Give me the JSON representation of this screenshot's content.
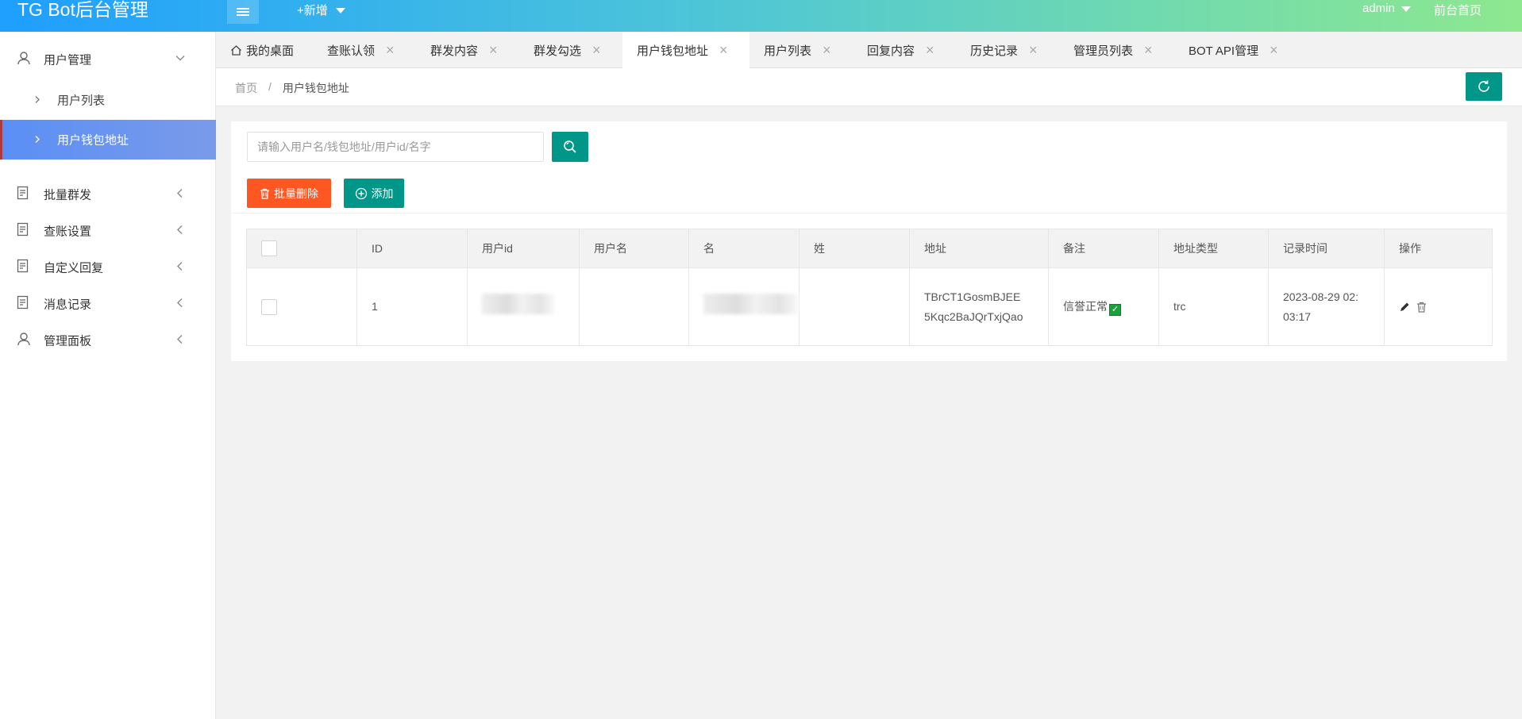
{
  "header": {
    "logo": "TG Bot后台管理",
    "add_new": "+新增",
    "admin": "admin",
    "front_home": "前台首页"
  },
  "sidebar": {
    "items": [
      {
        "label": "用户管理",
        "icon": "user-icon",
        "expanded": true
      },
      {
        "label": "用户列表",
        "sub": true
      },
      {
        "label": "用户钱包地址",
        "sub": true,
        "active": true
      },
      {
        "label": "批量群发",
        "icon": "doc-icon"
      },
      {
        "label": "查账设置",
        "icon": "doc-icon"
      },
      {
        "label": "自定义回复",
        "icon": "doc-icon"
      },
      {
        "label": "消息记录",
        "icon": "doc-icon"
      },
      {
        "label": "管理面板",
        "icon": "user-icon"
      }
    ]
  },
  "tabs": [
    {
      "label": "我的桌面",
      "home": true
    },
    {
      "label": "查账认领"
    },
    {
      "label": "群发内容"
    },
    {
      "label": "群发勾选"
    },
    {
      "label": "用户钱包地址",
      "active": true
    },
    {
      "label": "用户列表"
    },
    {
      "label": "回复内容"
    },
    {
      "label": "历史记录"
    },
    {
      "label": "管理员列表"
    },
    {
      "label": "BOT API管理"
    }
  ],
  "breadcrumb": {
    "home": "首页",
    "separator": "/",
    "current": "用户钱包地址"
  },
  "search": {
    "placeholder": "请输入用户名/钱包地址/用户id/名字",
    "value": ""
  },
  "toolbar": {
    "batch_delete": "批量删除",
    "add": "添加"
  },
  "table": {
    "columns": [
      "",
      "ID",
      "用户id",
      "用户名",
      "名",
      "姓",
      "地址",
      "备注",
      "地址类型",
      "记录时间",
      "操作"
    ],
    "rows": [
      {
        "id": "1",
        "user_id": "",
        "username": "",
        "first_name": "",
        "last_name": "",
        "address_line1": "TBrCT1GosmBJEE",
        "address_line2": "5Kqc2BaJQrTxjQao",
        "remark": "信誉正常",
        "address_type": "trc",
        "time_line1": "2023-08-29 02:",
        "time_line2": "03:17"
      }
    ]
  },
  "colors": {
    "primary": "#009688",
    "danger": "#ff5722",
    "active_nav": "#5a8ff5"
  }
}
